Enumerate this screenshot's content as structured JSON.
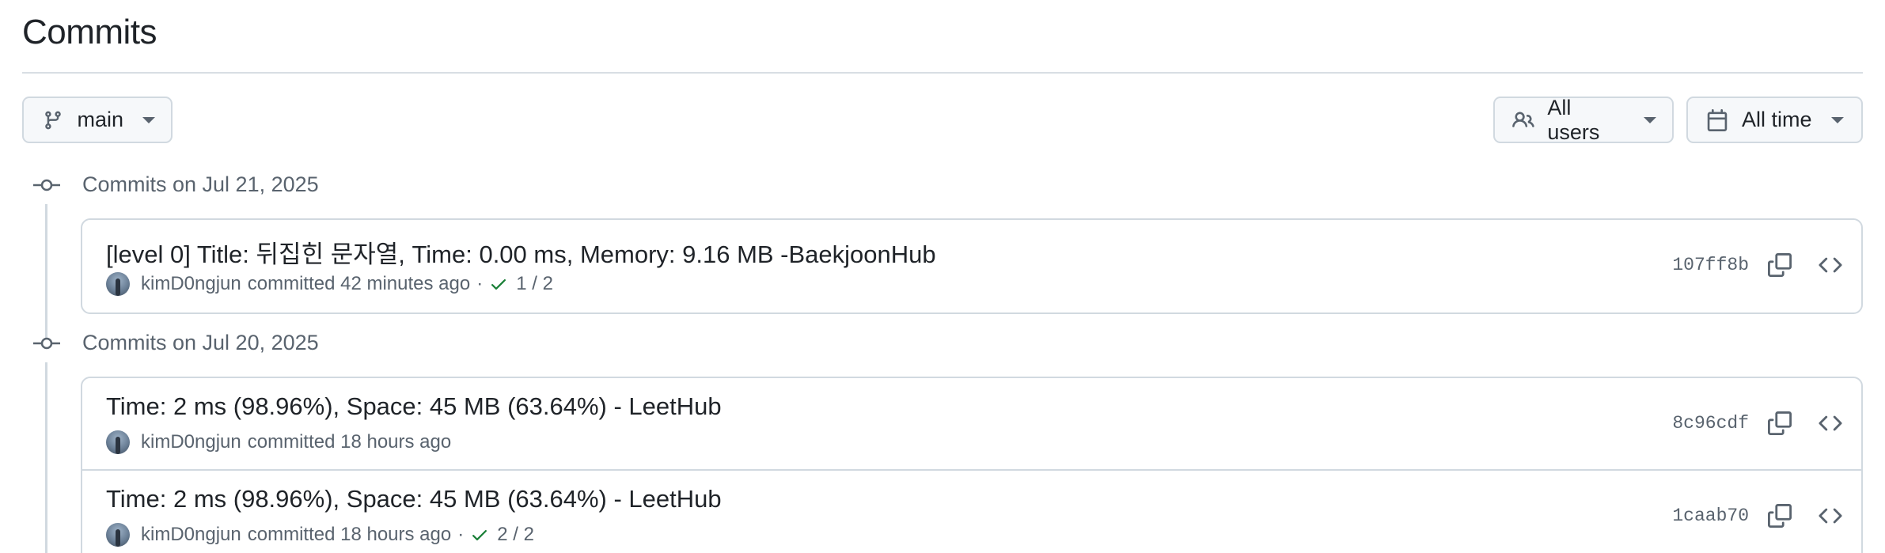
{
  "page": {
    "title": "Commits"
  },
  "filters": {
    "branch": {
      "label": "main",
      "icon": "git-branch-icon"
    },
    "users": {
      "label": "All users",
      "icon": "people-icon"
    },
    "time": {
      "label": "All time",
      "icon": "calendar-icon"
    }
  },
  "groups": [
    {
      "heading": "Commits on Jul 21, 2025",
      "commits": [
        {
          "message": "[level 0] Title: 뒤집힌 문자열, Time: 0.00 ms, Memory: 9.16 MB -BaekjoonHub",
          "author": "kimD0ngjun",
          "action": "committed",
          "time": "42 minutes ago",
          "checks": "1 / 2",
          "sha": "107ff8b"
        }
      ]
    },
    {
      "heading": "Commits on Jul 20, 2025",
      "commits": [
        {
          "message": "Time: 2 ms (98.96%), Space: 45 MB (63.64%) - LeetHub",
          "author": "kimD0ngjun",
          "action": "committed",
          "time": "18 hours ago",
          "checks": "",
          "sha": "8c96cdf"
        },
        {
          "message": "Time: 2 ms (98.96%), Space: 45 MB (63.64%) - LeetHub",
          "author": "kimD0ngjun",
          "action": "committed",
          "time": "18 hours ago",
          "checks": "2 / 2",
          "sha": "1caab70"
        }
      ]
    }
  ],
  "colors": {
    "success": "#1a7f37",
    "muted": "#59636e",
    "border": "#d1d9e0"
  }
}
